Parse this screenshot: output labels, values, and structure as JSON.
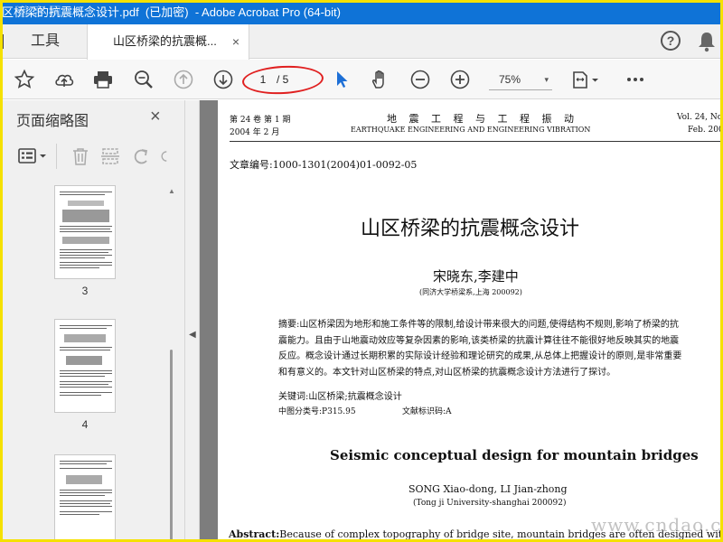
{
  "window": {
    "title_parts": [
      "区桥梁的抗震概念设计.pdf",
      "(已加密)",
      "- Adobe Acrobat Pro (64-bit)"
    ]
  },
  "tabs": {
    "tools_label": "工具",
    "doc_tab_label": "山区桥梁的抗震概...",
    "close_glyph": "×",
    "help_glyph": "?"
  },
  "toolbar": {
    "current_page": "1",
    "total_pages": "/ 5",
    "zoom": "75%",
    "zoom_caret": "▾"
  },
  "panel": {
    "title": "页面缩略图",
    "close_glyph": "×",
    "thumbnails": [
      {
        "label": "3"
      },
      {
        "label": "4"
      },
      {
        "label": ""
      }
    ]
  },
  "document": {
    "header_left_1": "第 24 卷 第 1 期",
    "header_left_2": "2004 年 2 月",
    "header_center_1": "地 震 工 程 与 工 程 振 动",
    "header_center_2": "EARTHQUAKE ENGINEERING AND ENGINEERING VIBRATION",
    "header_right_1": "Vol. 24, No",
    "header_right_2": "Feb. 200",
    "article_no": "文章编号:1000-1301(2004)01-0092-05",
    "zh_title": "山区桥梁的抗震概念设计",
    "zh_authors": "宋晓东,李建中",
    "zh_affiliation": "(同济大学桥梁系,上海 200092)",
    "zh_abstract": "摘要:山区桥梁因为地形和施工条件等的限制,给设计带来很大的问题,使得结构不规则,影响了桥梁的抗震能力。且由于山地震动效应等复杂因素的影响,该类桥梁的抗震计算往往不能很好地反映其实的地震反应。概念设计通过长期积累的实际设计经验和理论研究的成果,从总体上把握设计的原则,是非常重要和有意义的。本文针对山区桥梁的特点,对山区桥梁的抗震概念设计方法进行了探讨。",
    "zh_keywords": "关键词:山区桥梁;抗震概念设计",
    "zh_class": "中图分类号:P315.95",
    "zh_doccode": "文献标识码:A",
    "en_title": "Seismic conceptual design for mountain bridges",
    "en_authors": "SONG Xiao-dong, LI Jian-zhong",
    "en_affiliation": "(Tong ji University-shanghai 200092)",
    "en_abstract_label": "Abstract:",
    "en_abstract_text": "Because of complex topography of bridge site, mountain bridges are often designed with unconvention"
  },
  "watermarks": {
    "cn": "道 客 网",
    "url": "www.cndao.com"
  }
}
